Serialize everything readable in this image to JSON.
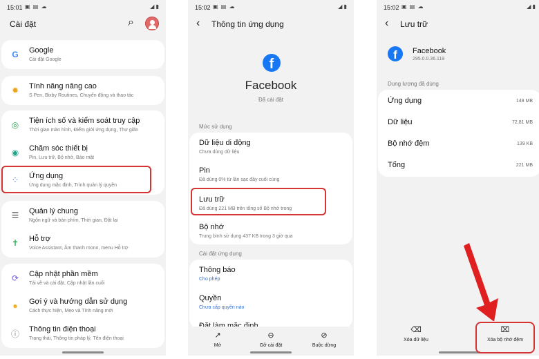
{
  "status": {
    "s1_time": "15:01",
    "s2_time": "15:02",
    "s3_time": "15:02",
    "status_icons": "▣ ▤ ☁",
    "system_icons": "◢ ▮"
  },
  "settings_screen": {
    "title": "Cài đặt",
    "items": [
      {
        "title": "Google",
        "subtitle": "Cài đặt Google"
      },
      {
        "title": "Tính năng nâng cao",
        "subtitle": "S Pen, Bixby Routines, Chuyển động và thao tác"
      },
      {
        "title": "Tiện ích số và kiểm soát truy cập",
        "subtitle": "Thời gian màn hình, Điểm giới ứng dụng, Thư giãn"
      },
      {
        "title": "Chăm sóc thiết bị",
        "subtitle": "Pin, Lưu trữ, Bộ nhớ, Bảo mật"
      },
      {
        "title": "Ứng dụng",
        "subtitle": "Ứng dụng mặc định, Trình quản lý quyền"
      },
      {
        "title": "Quản lý chung",
        "subtitle": "Ngôn ngữ và bàn phím, Thời gian, Đặt lại"
      },
      {
        "title": "Hỗ trợ",
        "subtitle": "Voice Assistant, Âm thanh mono, menu Hỗ trợ"
      },
      {
        "title": "Cập nhật phần mềm",
        "subtitle": "Tải về và cài đặt, Cập nhật lần cuối"
      },
      {
        "title": "Gợi ý và hướng dẫn sử dụng",
        "subtitle": "Cách thực hiện, Mẹo và Tính năng mới"
      },
      {
        "title": "Thông tin điện thoại",
        "subtitle": "Trạng thái, Thông tin pháp lý, Tên điện thoại"
      }
    ]
  },
  "app_info_screen": {
    "title": "Thông tin ứng dụng",
    "app_name": "Facebook",
    "install_status": "Đã cài đặt",
    "section_usage": "Mức sử dụng",
    "usage_rows": [
      {
        "title": "Dữ liệu di động",
        "subtitle": "Chưa dùng dữ liệu"
      },
      {
        "title": "Pin",
        "subtitle": "Đã dùng 0% từ lần sạc đầy cuối cùng"
      },
      {
        "title": "Lưu trữ",
        "subtitle": "Đã dùng 221 MB trên tổng số Bộ nhớ trong"
      },
      {
        "title": "Bộ nhớ",
        "subtitle": "Trung bình sử dụng 437 KB trong 3 giờ qua"
      }
    ],
    "section_app_settings": "Cài đặt ứng dụng",
    "settings_rows": [
      {
        "title": "Thông báo",
        "subtitle": "Cho phép"
      },
      {
        "title": "Quyền",
        "subtitle": "Chưa cấp quyền nào"
      },
      {
        "title": "Đặt làm mặc định",
        "subtitle": ""
      }
    ],
    "bottom_actions": [
      {
        "label": "Mở",
        "icon": "↗"
      },
      {
        "label": "Gỡ cài đặt",
        "icon": "⊖"
      },
      {
        "label": "Buộc dừng",
        "icon": "⊘"
      }
    ]
  },
  "storage_screen": {
    "title": "Lưu trữ",
    "app_name": "Facebook",
    "app_version": "295.0.0.36.119",
    "section": "Dung lượng đã dùng",
    "rows": [
      {
        "label": "Ứng dụng",
        "value": "148 MB"
      },
      {
        "label": "Dữ liệu",
        "value": "72,81 MB"
      },
      {
        "label": "Bộ nhớ đệm",
        "value": "139 KB"
      },
      {
        "label": "Tổng",
        "value": "221 MB"
      }
    ],
    "bottom_actions": [
      {
        "label": "Xóa dữ liệu",
        "icon": "⌫"
      },
      {
        "label": "Xóa bộ nhớ đệm",
        "icon": "⌧"
      }
    ]
  },
  "colors": {
    "highlight": "#d63333",
    "facebook_blue": "#1877f2",
    "link_blue": "#2f6fd6"
  },
  "icons": {
    "fb_glyph": "f",
    "search": "⌕",
    "back": "‹"
  }
}
